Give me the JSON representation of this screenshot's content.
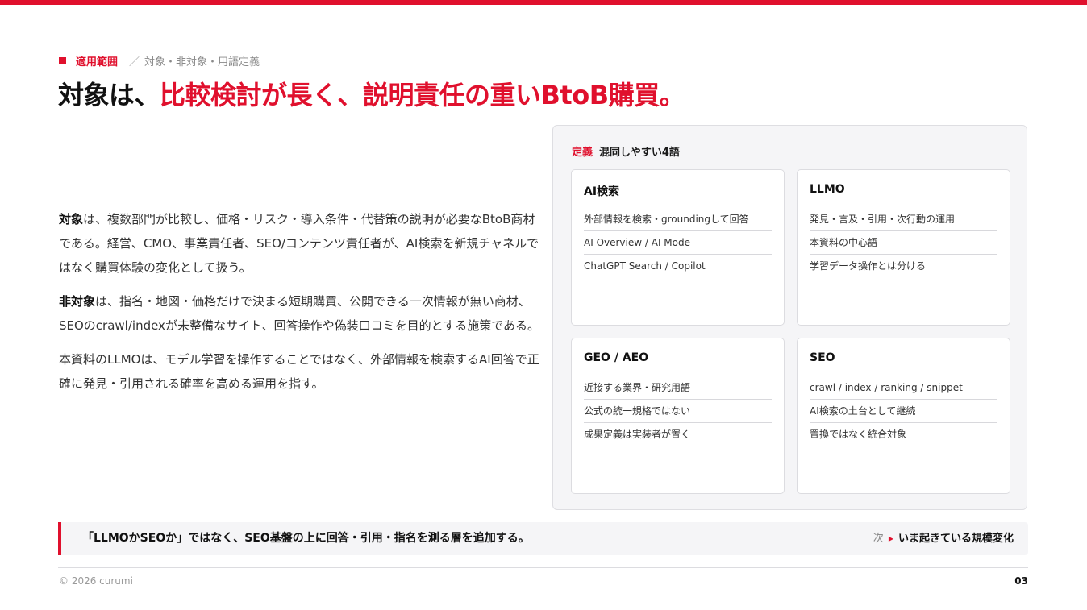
{
  "eyebrow": {
    "section": "適用範囲",
    "separator": "／",
    "subtitle": "対象・非対象・用語定義"
  },
  "title": {
    "part1": "対象は、",
    "part2": "比較検討が長く、説明責任の重いBtoB購買。"
  },
  "body": {
    "p1_label": "対象",
    "p1_text": "は、複数部門が比較し、価格・リスク・導入条件・代替策の説明が必要なBtoB商材である。経営、CMO、事業責任者、SEO/コンテンツ責任者が、AI検索を新規チャネルではなく購買体験の変化として扱う。",
    "p2_label": "非対象",
    "p2_text": "は、指名・地図・価格だけで決まる短期購買、公開できる一次情報が無い商材、SEOのcrawl/indexが未整備なサイト、回答操作や偽装口コミを目的とする施策である。",
    "p3_text": "本資料のLLMOは、モデル学習を操作することではなく、外部情報を検索するAI回答で正確に発見・引用される確率を高める運用を指す。"
  },
  "definitions": {
    "tag": "定義",
    "label": "混同しやすい4語",
    "cards": [
      {
        "title": "AI検索",
        "rows": [
          "外部情報を検索・groundingして回答",
          "AI Overview / AI Mode",
          "ChatGPT Search / Copilot"
        ]
      },
      {
        "title": "LLMO",
        "rows": [
          "発見・言及・引用・次行動の運用",
          "本資料の中心語",
          "学習データ操作とは分ける"
        ]
      },
      {
        "title": "GEO / AEO",
        "rows": [
          "近接する業界・研究用語",
          "公式の統一規格ではない",
          "成果定義は実装者が置く"
        ]
      },
      {
        "title": "SEO",
        "rows": [
          "crawl / index / ranking / snippet",
          "AI検索の土台として継続",
          "置換ではなく統合対象"
        ]
      }
    ]
  },
  "callout": {
    "text": "「LLMOかSEOか」ではなく、SEO基盤の上に回答・引用・指名を測る層を追加する。",
    "next_label": "次",
    "next_value": "いま起きている規模変化"
  },
  "footer": {
    "copyright": "© 2026 curumi",
    "page": "03"
  },
  "colors": {
    "accent": "#e0102d",
    "panel_bg": "#f5f5f7"
  }
}
